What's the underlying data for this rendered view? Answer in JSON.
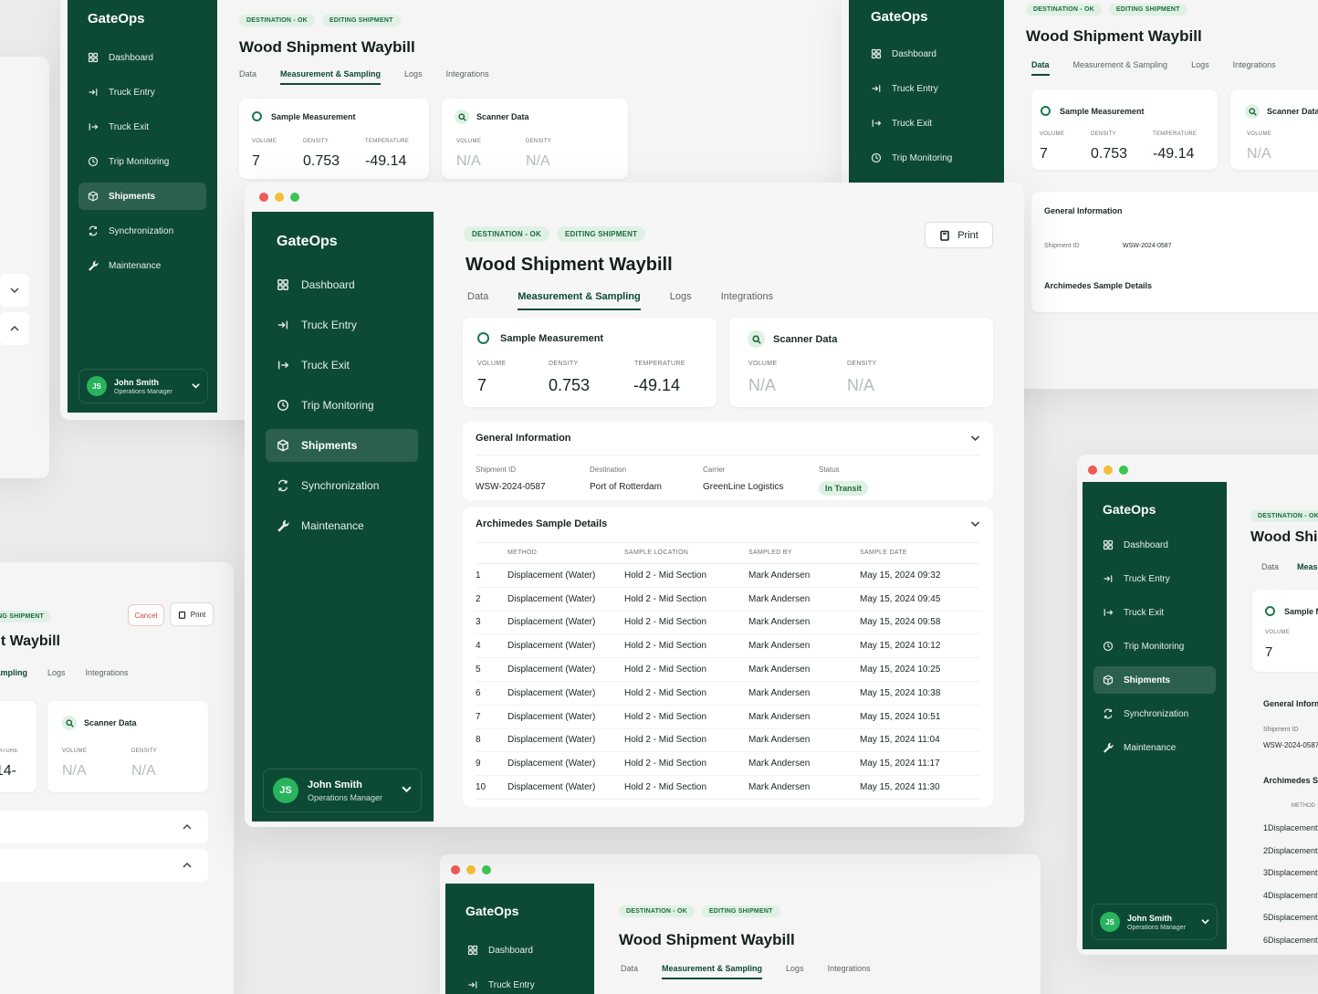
{
  "app": {
    "name": "GateOps"
  },
  "badges": {
    "destination": "DESTINATION - OK",
    "editing": "EDITING SHIPMENT"
  },
  "page": {
    "title": "Wood Shipment Waybill",
    "print": "Print",
    "cancel": "Cancel"
  },
  "tabs": [
    "Data",
    "Measurement & Sampling",
    "Logs",
    "Integrations"
  ],
  "nav": [
    "Dashboard",
    "Truck Entry",
    "Truck Exit",
    "Trip Monitoring",
    "Shipments",
    "Synchronization",
    "Maintenance"
  ],
  "nav_icons": [
    "grid-icon",
    "arrow-in-icon",
    "arrow-out-icon",
    "clock-icon",
    "box-icon",
    "sync-icon",
    "wrench-icon"
  ],
  "user": {
    "initials": "JS",
    "name": "John Smith",
    "role": "Operations Manager"
  },
  "sample_measurement": {
    "title": "Sample Measurement",
    "volume_label": "VOLUME",
    "volume": "7",
    "density_label": "DENSITY",
    "density": "0.753",
    "temperature_label": "TEMPERATURE",
    "temperature": "-49.14"
  },
  "scanner": {
    "title": "Scanner Data",
    "volume_label": "VOLUME",
    "volume": "N/A",
    "density_label": "DENSITY",
    "density": "N/A"
  },
  "general": {
    "title": "General Information",
    "shipment_id_label": "Shipment ID",
    "shipment_id": "WSW-2024-0587",
    "destination_label": "Destination",
    "destination": "Port of Rotterdam",
    "carrier_label": "Carrier",
    "carrier": "GreenLine Logistics",
    "status_label": "Status",
    "status": "In Transit"
  },
  "archimedes": {
    "title": "Archimedes Sample Details",
    "columns": [
      "METHOD",
      "SAMPLE LOCATION",
      "SAMPLED BY",
      "SAMPLE DATE"
    ],
    "rows": [
      [
        "1",
        "Displacement (Water)",
        "Hold 2 - Mid Section",
        "Mark Andersen",
        "May 15, 2024 09:32"
      ],
      [
        "2",
        "Displacement (Water)",
        "Hold 2 - Mid Section",
        "Mark Andersen",
        "May 15, 2024 09:45"
      ],
      [
        "3",
        "Displacement (Water)",
        "Hold 2 - Mid Section",
        "Mark Andersen",
        "May 15, 2024 09:58"
      ],
      [
        "4",
        "Displacement (Water)",
        "Hold 2 - Mid Section",
        "Mark Andersen",
        "May 15, 2024 10:12"
      ],
      [
        "5",
        "Displacement (Water)",
        "Hold 2 - Mid Section",
        "Mark Andersen",
        "May 15, 2024 10:25"
      ],
      [
        "6",
        "Displacement (Water)",
        "Hold 2 - Mid Section",
        "Mark Andersen",
        "May 15, 2024 10:38"
      ],
      [
        "7",
        "Displacement (Water)",
        "Hold 2 - Mid Section",
        "Mark Andersen",
        "May 15, 2024 10:51"
      ],
      [
        "8",
        "Displacement (Water)",
        "Hold 2 - Mid Section",
        "Mark Andersen",
        "May 15, 2024 11:04"
      ],
      [
        "9",
        "Displacement (Water)",
        "Hold 2 - Mid Section",
        "Mark Andersen",
        "May 15, 2024 11:17"
      ],
      [
        "10",
        "Displacement (Water)",
        "Hold 2 - Mid Section",
        "Mark Andersen",
        "May 15, 2024 11:30"
      ]
    ]
  },
  "colors": {
    "sidebar": "#0d4a35",
    "accent": "#27b45d",
    "badge_bg": "#dff1e4"
  }
}
